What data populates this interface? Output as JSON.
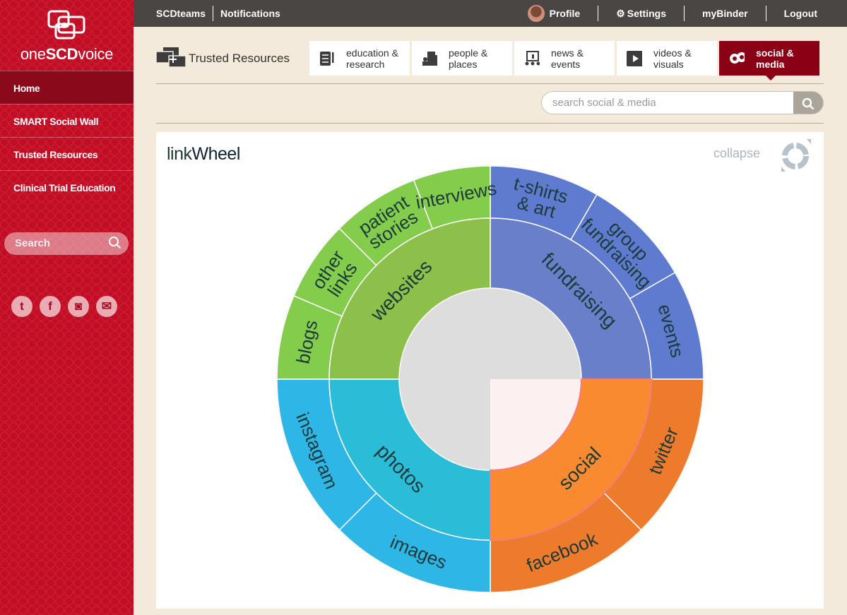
{
  "brand": {
    "name_prefix": "one",
    "name_bold": "SCD",
    "name_suffix": "voice"
  },
  "sidebar": {
    "items": [
      {
        "label": "Home"
      },
      {
        "label": "SMART Social Wall"
      },
      {
        "label": "Trusted Resources"
      },
      {
        "label": "Clinical Trial Education"
      }
    ],
    "search_placeholder": "Search",
    "social_icons": [
      "twitter-icon",
      "facebook-icon",
      "instagram-icon",
      "email-icon"
    ]
  },
  "topbar": {
    "left": [
      "SCDteams",
      "Notifications"
    ],
    "profile": "Profile",
    "settings": "Settings",
    "binder": "myBinder",
    "logout": "Logout"
  },
  "header": {
    "title": "Trusted Resources"
  },
  "tabs": [
    {
      "label1": "education &",
      "label2": "research",
      "icon": "checklist-icon"
    },
    {
      "label1": "people &",
      "label2": "places",
      "icon": "buildings-icon"
    },
    {
      "label1": "news &",
      "label2": "events",
      "icon": "presentation-icon"
    },
    {
      "label1": "videos &",
      "label2": "visuals",
      "icon": "play-icon"
    },
    {
      "label1": "social &",
      "label2": "media",
      "icon": "chat-bubbles-icon",
      "active": true
    }
  ],
  "search": {
    "placeholder": "search social & media"
  },
  "panel": {
    "title_light": "link",
    "title_bold": "Wheel",
    "collapse": "collapse"
  },
  "chart_data": {
    "type": "sunburst",
    "title": "linkWheel",
    "hovered": "social",
    "inner": [
      {
        "label": [
          "fundraising"
        ],
        "start": 0,
        "end": 90,
        "color": "#6a7fc9"
      },
      {
        "label": [
          "social"
        ],
        "start": 90,
        "end": 180,
        "color": "#f98a30"
      },
      {
        "label": [
          "photos"
        ],
        "start": 180,
        "end": 270,
        "color": "#2bbdd8"
      },
      {
        "label": [
          "websites"
        ],
        "start": 270,
        "end": 360,
        "color": "#8dc04a"
      }
    ],
    "outer": [
      {
        "label": [
          "t-shirts",
          "& art"
        ],
        "start": 0,
        "end": 30,
        "color": "#5f7bcf"
      },
      {
        "label": [
          "group",
          "fundraising"
        ],
        "start": 30,
        "end": 60,
        "color": "#5f7bcf"
      },
      {
        "label": [
          "events"
        ],
        "start": 60,
        "end": 90,
        "color": "#5f7bcf"
      },
      {
        "label": [
          "twitter"
        ],
        "start": 90,
        "end": 135,
        "color": "#ee7a2b"
      },
      {
        "label": [
          "facebook"
        ],
        "start": 135,
        "end": 180,
        "color": "#ee7a2b"
      },
      {
        "label": [
          "images"
        ],
        "start": 180,
        "end": 225,
        "color": "#2db6e6"
      },
      {
        "label": [
          "instagram"
        ],
        "start": 225,
        "end": 270,
        "color": "#2db6e6"
      },
      {
        "label": [
          "blogs"
        ],
        "start": 270,
        "end": 293,
        "color": "#84cc4b"
      },
      {
        "label": [
          "other",
          "links"
        ],
        "start": 293,
        "end": 315,
        "color": "#84cc4b"
      },
      {
        "label": [
          "patient",
          "stories"
        ],
        "start": 315,
        "end": 339,
        "color": "#84cc4b"
      },
      {
        "label": [
          "interviews"
        ],
        "start": 339,
        "end": 360,
        "color": "#84cc4b"
      }
    ]
  }
}
